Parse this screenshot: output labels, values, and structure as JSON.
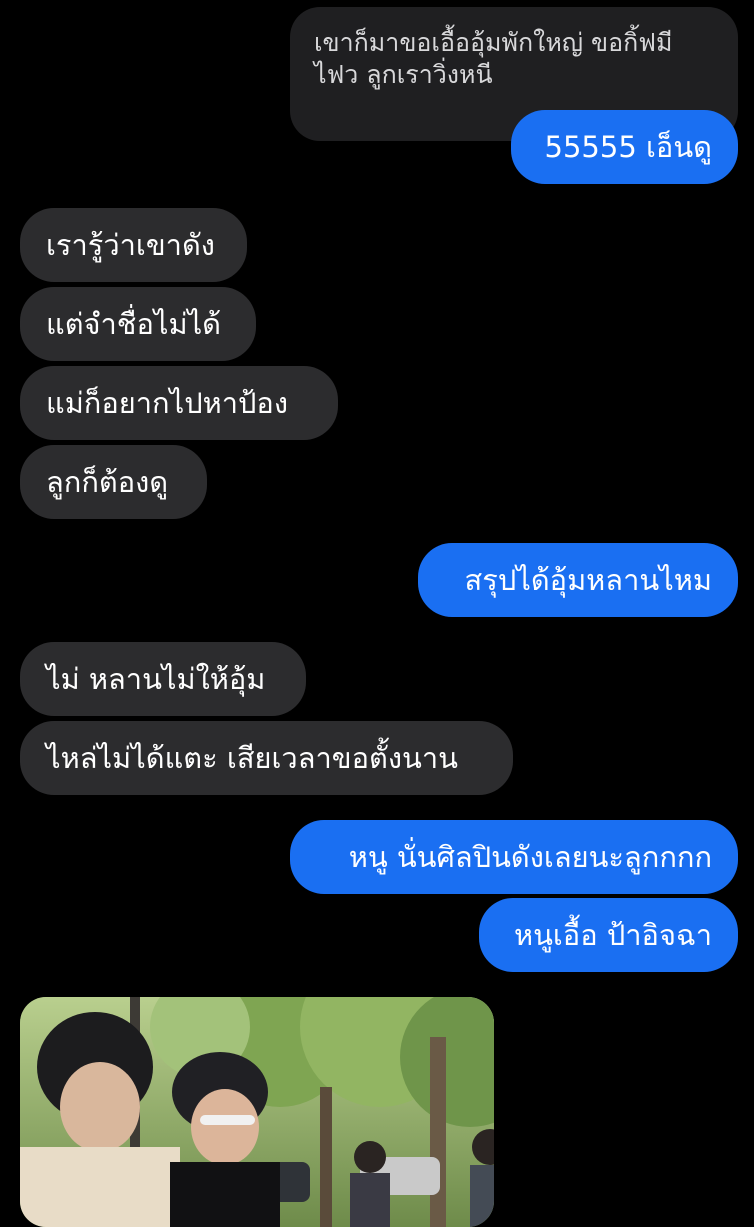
{
  "conversation": {
    "quoted_message": "เขาก็มาขอเอื้ออุ้มพักใหญ่ ขอกิ้ฟมีไฟว ลูกเราวิ่งหนี",
    "messages": [
      {
        "side": "out",
        "text": "55555 เอ็นดู"
      },
      {
        "side": "in",
        "text": "เรารู้ว่าเขาดัง"
      },
      {
        "side": "in",
        "text": "แต่จำชื่อไม่ได้"
      },
      {
        "side": "in",
        "text": "แม่ก็อยากไปหาป้อง"
      },
      {
        "side": "in",
        "text": "ลูกก็ต้องดู"
      },
      {
        "side": "out",
        "text": "สรุปได้อุ้มหลานไหม"
      },
      {
        "side": "in",
        "text": "ไม่ หลานไม่ให้อุ้ม"
      },
      {
        "side": "in",
        "text": "ไหล่ไม่ได้แตะ เสียเวลาขอตั้งนาน"
      },
      {
        "side": "out",
        "text": "หนู นั่นศิลปินดังเลยนะลูกกกก"
      },
      {
        "side": "out",
        "text": "หนูเอื้อ ป้าอิจฉา"
      }
    ]
  },
  "colors": {
    "background": "#000000",
    "incoming_bubble": "#2c2c2e",
    "outgoing_bubble": "#1a6ff2",
    "text": "#ffffff"
  }
}
